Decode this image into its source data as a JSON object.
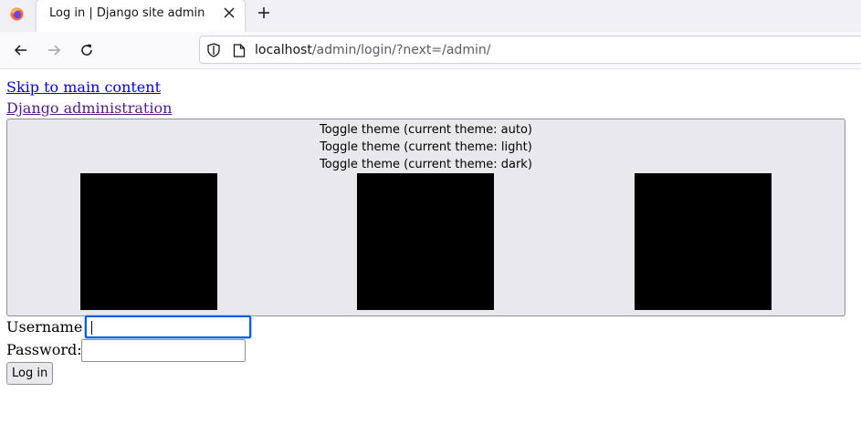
{
  "browser": {
    "tab_title": "Log in | Django site admin",
    "url_host": "localhost",
    "url_path": "/admin/login/?next=/admin/"
  },
  "page": {
    "skip_link": "Skip to main content",
    "site_name": "Django administration",
    "theme_toggle": {
      "labels": [
        "Toggle theme (current theme: auto)",
        "Toggle theme (current theme: light)",
        "Toggle theme (current theme: dark)"
      ],
      "icon_names": [
        "theme-auto-icon",
        "theme-light-icon",
        "theme-dark-icon"
      ]
    },
    "form": {
      "username_label": "Username:",
      "username_value": "",
      "password_label": "Password:",
      "password_value": "",
      "submit_label": "Log in"
    }
  },
  "colors": {
    "link": "#0000ee",
    "visited_link": "#551a8b",
    "focus_ring": "#0060df",
    "theme_box_bg": "#e9e9ed"
  }
}
